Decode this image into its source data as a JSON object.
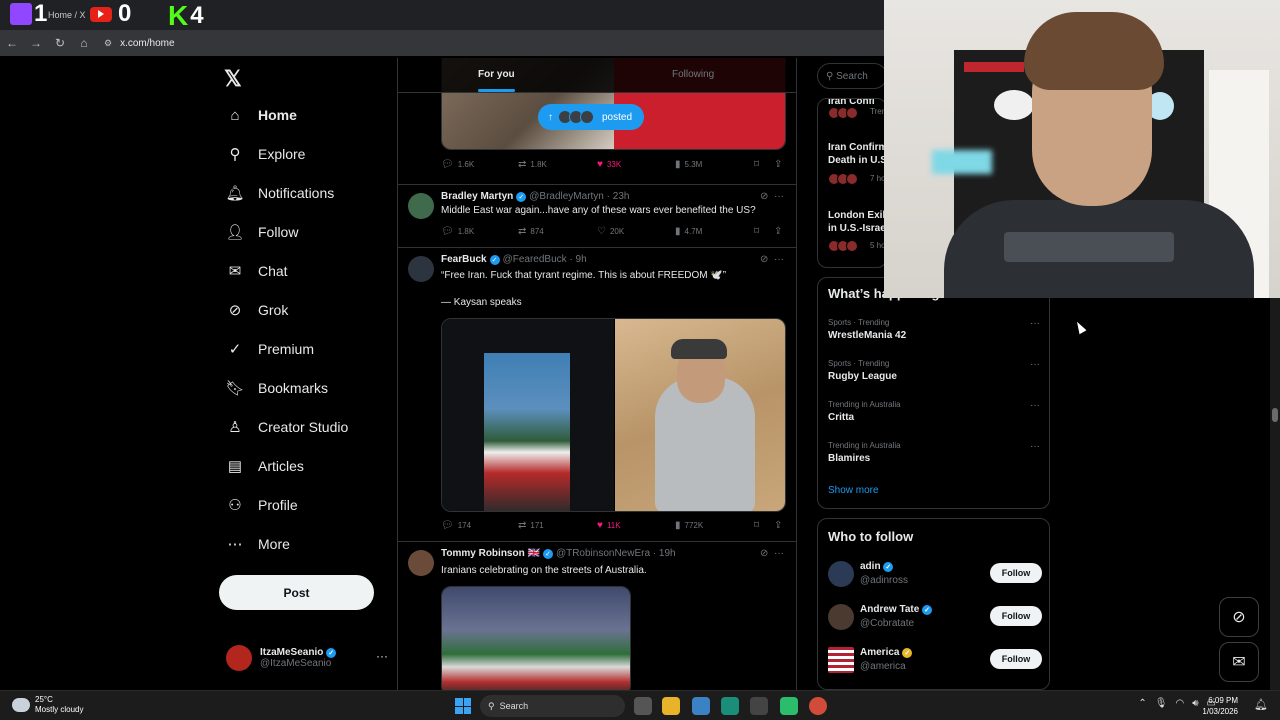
{
  "browser": {
    "tab_title": "Home / X",
    "counters": {
      "twitch": "1",
      "youtube": "0",
      "kick": "4"
    },
    "url": "x.com/home"
  },
  "nav": {
    "items": [
      {
        "label": "Home",
        "icon": "home-icon"
      },
      {
        "label": "Explore",
        "icon": "search-icon"
      },
      {
        "label": "Notifications",
        "icon": "bell-icon"
      },
      {
        "label": "Follow",
        "icon": "person-plus-icon"
      },
      {
        "label": "Chat",
        "icon": "mail-icon"
      },
      {
        "label": "Grok",
        "icon": "grok-icon"
      },
      {
        "label": "Premium",
        "icon": "verified-icon"
      },
      {
        "label": "Bookmarks",
        "icon": "bookmark-icon"
      },
      {
        "label": "Creator Studio",
        "icon": "creator-icon"
      },
      {
        "label": "Articles",
        "icon": "articles-icon"
      },
      {
        "label": "Profile",
        "icon": "profile-icon"
      },
      {
        "label": "More",
        "icon": "more-circle-icon"
      }
    ],
    "post_label": "Post",
    "account": {
      "name": "ItzaMeSeanio",
      "handle": "@ItzaMeSeanio"
    }
  },
  "feed": {
    "tabs": [
      "For you",
      "Following"
    ],
    "posted_pill": "posted",
    "top_actions": {
      "replies": "1.6K",
      "reposts": "1.8K",
      "likes": "33K",
      "views": "5.3M"
    },
    "tweets": [
      {
        "name": "Bradley Martyn",
        "handle": "@BradleyMartyn",
        "time": "· 23h",
        "text": "Middle East war again...have any of these wars ever benefited the US?",
        "replies": "1.8K",
        "reposts": "874",
        "likes": "20K",
        "views": "4.7M"
      },
      {
        "name": "FearBuck",
        "handle": "@FearedBuck",
        "time": "· 9h",
        "text": "“Free Iran. Fuck that tyrant regime. This is about FREEDOM 🕊️”",
        "text2": "— Kaysan speaks",
        "replies": "174",
        "reposts": "171",
        "likes": "11K",
        "views": "772K"
      },
      {
        "name": "Tommy Robinson 🇬🇧",
        "handle": "@TRobinsonNewEra",
        "time": "· 19h",
        "text": "Iranians celebrating on the streets of Australia."
      }
    ]
  },
  "right": {
    "search_placeholder": "Search",
    "news": [
      {
        "title": "Iran Confi",
        "meta": "Tren"
      },
      {
        "title": "Iran Confirm\nDeath in U.S",
        "meta": "7 ho"
      },
      {
        "title": "London Exil\nin U.S.-Israe",
        "meta": "5 ho"
      }
    ],
    "trends_title": "What’s happening",
    "trends": [
      {
        "category": "Sports · Trending",
        "name": "WrestleMania 42"
      },
      {
        "category": "Sports · Trending",
        "name": "Rugby League"
      },
      {
        "category": "Trending in Australia",
        "name": "Critta"
      },
      {
        "category": "Trending in Australia",
        "name": "Blamires"
      }
    ],
    "show_more": "Show more",
    "who_title": "Who to follow",
    "who": [
      {
        "name": "adin",
        "handle": "@adinross",
        "badge": "blue"
      },
      {
        "name": "Andrew Tate",
        "handle": "@Cobratate",
        "badge": "blue"
      },
      {
        "name": "America",
        "handle": "@america",
        "badge": "gold"
      }
    ],
    "follow_label": "Follow"
  },
  "taskbar": {
    "weather_temp": "25°C",
    "weather_desc": "Mostly cloudy",
    "search_label": "Search",
    "time": "6:09 PM",
    "date": "1/03/2026"
  },
  "colors": {
    "accent": "#1d9bf0",
    "like": "#f91880",
    "background": "#000000"
  }
}
